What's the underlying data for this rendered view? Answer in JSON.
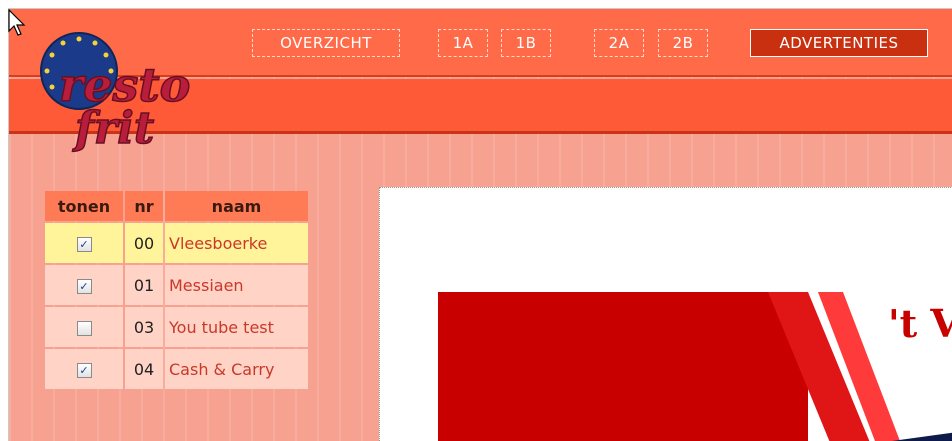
{
  "nav": {
    "items": [
      {
        "label": "OVERZICHT"
      },
      {
        "label": "1A"
      },
      {
        "label": "1B"
      },
      {
        "label": "2A"
      },
      {
        "label": "2B"
      },
      {
        "label": "ADVERTENTIES"
      }
    ],
    "active": "ADVERTENTIES"
  },
  "logo": {
    "text": "resto frit"
  },
  "table": {
    "headers": {
      "tonen": "tonen",
      "nr": "nr",
      "naam": "naam"
    },
    "rows": [
      {
        "checked": true,
        "nr": "00",
        "naam": "Vleesboerke",
        "selected": true
      },
      {
        "checked": true,
        "nr": "01",
        "naam": "Messiaen",
        "selected": false
      },
      {
        "checked": false,
        "nr": "03",
        "naam": "You tube test",
        "selected": false
      },
      {
        "checked": true,
        "nr": "04",
        "naam": "Cash & Carry",
        "selected": false
      }
    ]
  },
  "preview": {
    "ad_text_fragment": "'t V"
  },
  "colors": {
    "header_orange": "#ff6a48",
    "panel_salmon": "#f7a190",
    "row_selected": "#fff49a",
    "link_red": "#c9382a",
    "ad_red": "#c80000"
  },
  "icons": {
    "checkbox_checked": "check-icon",
    "cursor": "mouse-pointer-icon"
  }
}
